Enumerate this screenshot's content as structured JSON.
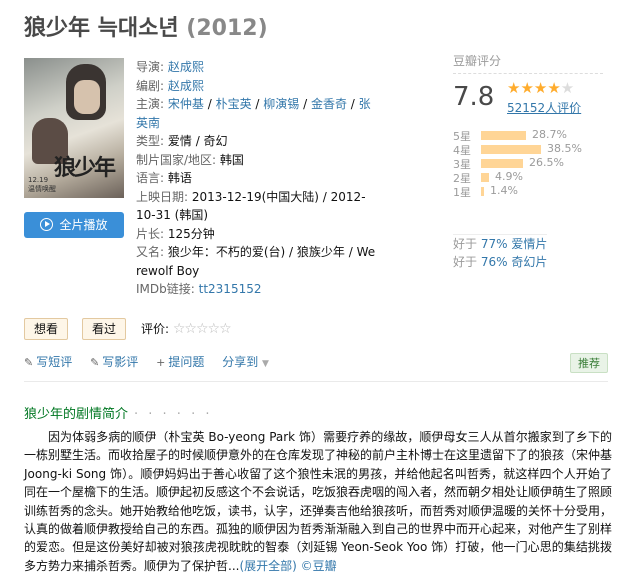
{
  "title": "狼少年 늑대소년",
  "year": "(2012)",
  "poster": {
    "title": "狼少年",
    "date": "12.19\n温情唤醒"
  },
  "play_label": "全片播放",
  "info": {
    "director_label": "导演:",
    "director": "赵成熙",
    "writer_label": "编剧:",
    "writer": "赵成熙",
    "cast_label": "主演:",
    "cast": [
      "宋仲基",
      "朴宝英",
      "柳演锡",
      "金香奇",
      "张英南"
    ],
    "genre_label": "类型:",
    "genre": "爱情 / 奇幻",
    "country_label": "制片国家/地区:",
    "country": "韩国",
    "language_label": "语言:",
    "language": "韩语",
    "release_label": "上映日期:",
    "release": "2013-12-19(中国大陆) / 2012-10-31 (韩国)",
    "runtime_label": "片长:",
    "runtime": "125分钟",
    "aka_label": "又名:",
    "aka": "狼少年：不朽的爱(台) / 狼族少年 / Werewolf Boy",
    "imdb_label": "IMDb链接:",
    "imdb": "tt2315152"
  },
  "rating": {
    "header": "豆瓣评分",
    "score": "7.8",
    "stars": 4,
    "votes": "52152人评价",
    "bars": [
      {
        "label": "5星",
        "pct": "28.7%",
        "value": 28.7
      },
      {
        "label": "4星",
        "pct": "38.5%",
        "value": 38.5
      },
      {
        "label": "3星",
        "pct": "26.5%",
        "value": 26.5
      },
      {
        "label": "2星",
        "pct": "4.9%",
        "value": 4.9
      },
      {
        "label": "1星",
        "pct": "1.4%",
        "value": 1.4
      }
    ],
    "better_prefix": "好于",
    "better": [
      {
        "pct": "77%",
        "genre": "爱情片"
      },
      {
        "pct": "76%",
        "genre": "奇幻片"
      }
    ]
  },
  "actions": {
    "want": "想看",
    "seen": "看过",
    "rate_label": "评价:"
  },
  "ops": {
    "short": "写短评",
    "review": "写影评",
    "question": "提问题",
    "share": "分享到",
    "recommend": "推荐"
  },
  "synopsis": {
    "heading": "狼少年的剧情简介",
    "dots": "· · · · · ·",
    "text": "因为体弱多病的顺伊（朴宝英 Bo-yeong Park 饰）需要疗养的缘故，顺伊母女三人从首尔搬家到了乡下的一栋别墅生活。而收拾屋子的时候顺伊意外的在仓库发现了神秘的前户主朴博士在这里遗留下了的狼孩（宋仲基 Joong-ki Song 饰）。顺伊妈妈出于善心收留了这个狼性未泯的男孩，并给他起名叫哲秀，就这样四个人开始了同在一个屋檐下的生活。顺伊起初反感这个不会说话，吃饭狼吞虎咽的闯入者，然而朝夕相处让顺伊萌生了照顾训练哲秀的念头。她开始教给他吃饭，读书，认字，还弹奏吉他给狼孩听，而哲秀对顺伊温暖的关怀十分受用，认真的做着顺伊教授给自己的东西。孤独的顺伊因为哲秀渐渐融入到自己的世界中而开心起来，对他产生了别样的爱恋。但是这份美好却被对狼孩虎视眈眈的智泰（刘延锡 Yeon-Seok Yoo 饰）打破，他一门心思的集结挑拨多方势力来捕杀哲秀。顺伊为了保护哲...",
    "more": "(展开全部)",
    "copyright": "©豆瓣"
  }
}
